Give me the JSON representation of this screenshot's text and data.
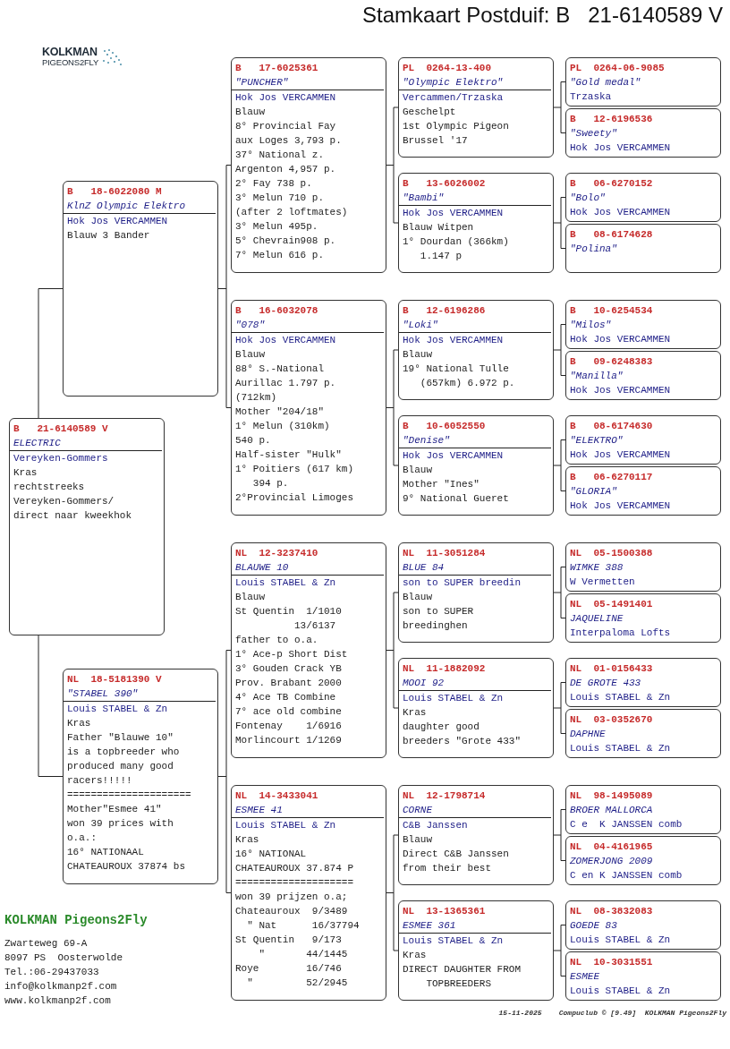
{
  "title": "Stamkaart Postduif: B   21-6140589 V",
  "logo": {
    "line1": "KOLKMAN",
    "line2": "PIGEONS2FLY"
  },
  "pedigree": {
    "ring": "B   21-6140589 V",
    "name": "ELECTRIC",
    "owner": "Vereyken-Gommers",
    "notes": [
      "Kras",
      "rechtstreeks",
      "Vereyken-Gommers/",
      "direct naar kweekhok"
    ],
    "sire": {
      "ring": "B   18-6022080 M",
      "name": "KlnZ Olympic Elektro",
      "owner": "Hok Jos VERCAMMEN",
      "notes": [
        "Blauw 3 Bander"
      ],
      "sire": {
        "ring": "B   17-6025361",
        "name": "\"PUNCHER\"",
        "owner": "Hok Jos VERCAMMEN",
        "notes": [
          "Blauw",
          "8° Provincial Fay",
          "aux Loges 3,793 p.",
          "37° National z.",
          "Argenton 4,957 p.",
          "2° Fay 738 p.",
          "3° Melun 710 p.",
          "(after 2 loftmates)",
          "3° Melun 495p.",
          "5° Chevrain908 p.",
          "7° Melun 616 p."
        ],
        "sire": {
          "ring": "PL  0264-13-400",
          "name": "\"Olympic Elektro\"",
          "owner": "Vercammen/Trzaska",
          "notes": [
            "Geschelpt",
            "1st Olympic Pigeon",
            "Brussel '17"
          ],
          "sire": {
            "ring": "PL  0264-06-9085",
            "name": "\"Gold medal\"",
            "owner": "Trzaska"
          },
          "dam": {
            "ring": "B   12-6196536",
            "name": "\"Sweety\"",
            "owner": "Hok Jos VERCAMMEN"
          }
        },
        "dam": {
          "ring": "B   13-6026002",
          "name": "\"Bambi\"",
          "owner": "Hok Jos VERCAMMEN",
          "notes": [
            "Blauw Witpen",
            "1° Dourdan (366km)",
            "   1.147 p"
          ],
          "sire": {
            "ring": "B   06-6270152",
            "name": "\"Bolo\"",
            "owner": "Hok Jos VERCAMMEN"
          },
          "dam": {
            "ring": "B   08-6174628",
            "name": "\"Polina\""
          }
        }
      },
      "dam": {
        "ring": "B   16-6032078",
        "name": "\"078\"",
        "owner": "Hok Jos VERCAMMEN",
        "notes": [
          "Blauw",
          "88° S.-National",
          "Aurillac 1.797 p.",
          "(712km)",
          "Mother \"204/18\"",
          "1° Melun (310km)",
          "540 p.",
          "Half-sister \"Hulk\"",
          "1° Poitiers (617 km)",
          "   394 p.",
          "2°Provincial Limoges"
        ],
        "sire": {
          "ring": "B   12-6196286",
          "name": "\"Loki\"",
          "owner": "Hok Jos VERCAMMEN",
          "notes": [
            "Blauw",
            "19° National Tulle",
            "   (657km) 6.972 p."
          ],
          "sire": {
            "ring": "B   10-6254534",
            "name": "\"Milos\"",
            "owner": "Hok Jos VERCAMMEN"
          },
          "dam": {
            "ring": "B   09-6248383",
            "name": "\"Manilla\"",
            "owner": "Hok Jos VERCAMMEN"
          }
        },
        "dam": {
          "ring": "B   10-6052550",
          "name": "\"Denise\"",
          "owner": "Hok Jos VERCAMMEN",
          "notes": [
            "Blauw",
            "Mother \"Ines\"",
            "9° National Gueret"
          ],
          "sire": {
            "ring": "B   08-6174630",
            "name": "\"ELEKTRO\"",
            "owner": "Hok Jos VERCAMMEN"
          },
          "dam": {
            "ring": "B   06-6270117",
            "name": "\"GLORIA\"",
            "owner": "Hok Jos VERCAMMEN"
          }
        }
      }
    },
    "dam": {
      "ring": "NL  18-5181390 V",
      "name": "\"STABEL 390\"",
      "owner": "Louis STABEL & Zn",
      "notes": [
        "Kras",
        "Father \"Blauwe 10\"",
        "is a topbreeder who",
        "produced many good",
        "racers!!!!!",
        "=====================",
        "Mother\"Esmee 41\"",
        "won 39 prices with",
        "o.a.:",
        "16° NATIONAAL",
        "CHATEAUROUX 37874 bs"
      ],
      "sire": {
        "ring": "NL  12-3237410",
        "name": "BLAUWE 10",
        "owner": "Louis STABEL & Zn",
        "notes": [
          "Blauw",
          "St Quentin  1/1010",
          "          13/6137",
          "father to o.a.",
          "1° Ace-p Short Dist",
          "3° Gouden Crack YB",
          "Prov. Brabant 2000",
          "4° Ace TB Combine",
          "7° ace old combine",
          "Fontenay    1/6916",
          "Morlincourt 1/1269"
        ],
        "sire": {
          "ring": "NL  11-3051284",
          "name": "BLUE 84",
          "owner": "son to SUPER breedin",
          "notes": [
            "Blauw",
            "son to SUPER",
            "breedinghen"
          ],
          "sire": {
            "ring": "NL  05-1500388",
            "name": "WIMKE 388",
            "owner": "W Vermetten"
          },
          "dam": {
            "ring": "NL  05-1491401",
            "name": "JAQUELINE",
            "owner": "Interpaloma Lofts"
          }
        },
        "dam": {
          "ring": "NL  11-1882092",
          "name": "MOOI 92",
          "owner": "Louis STABEL & Zn",
          "notes": [
            "Kras",
            "daughter good",
            "breeders \"Grote 433\""
          ],
          "sire": {
            "ring": "NL  01-0156433",
            "name": "DE GROTE 433",
            "owner": "Louis STABEL & Zn"
          },
          "dam": {
            "ring": "NL  03-0352670",
            "name": "DAPHNE",
            "owner": "Louis STABEL & Zn"
          }
        }
      },
      "dam": {
        "ring": "NL  14-3433041",
        "name": "ESMEE 41",
        "owner": "Louis STABEL & Zn",
        "notes": [
          "Kras",
          "16° NATIONAL",
          "CHATEAUROUX 37.874 P",
          "====================",
          "won 39 prijzen o.a;",
          "Chateauroux  9/3489",
          "  \" Nat      16/37794",
          "St Quentin   9/173",
          "    \"       44/1445",
          "Roye        16/746",
          "  \"         52/2945"
        ],
        "sire": {
          "ring": "NL  12-1798714",
          "name": "CORNE",
          "owner": "C&B Janssen",
          "notes": [
            "Blauw",
            "Direct C&B Janssen",
            "from their best"
          ],
          "sire": {
            "ring": "NL  98-1495089",
            "name": "BROER MALLORCA",
            "owner": "C e  K JANSSEN comb"
          },
          "dam": {
            "ring": "NL  04-4161965",
            "name": "ZOMERJONG 2009",
            "owner": "C en K JANSSEN comb"
          }
        },
        "dam": {
          "ring": "NL  13-1365361",
          "name": "ESMEE 361",
          "owner": "Louis STABEL & Zn",
          "notes": [
            "Kras",
            "DIRECT DAUGHTER FROM",
            "    TOPBREEDERS"
          ],
          "sire": {
            "ring": "NL  08-3832083",
            "name": "GOEDE 83",
            "owner": "Louis STABEL & Zn"
          },
          "dam": {
            "ring": "NL  10-3031551",
            "name": "ESMEE",
            "owner": "Louis STABEL & Zn"
          }
        }
      }
    }
  },
  "footer": {
    "company": "KOLKMAN Pigeons2Fly",
    "address": [
      "Zwarteweg 69-A",
      "8097 PS  Oosterwolde",
      "Tel.:06-29437033",
      "info@kolkmanp2f.com",
      "www.kolkmanp2f.com"
    ]
  },
  "print_line": "15-11-2025    Compuclub © [9.49]  KOLKMAN Pigeons2Fly"
}
